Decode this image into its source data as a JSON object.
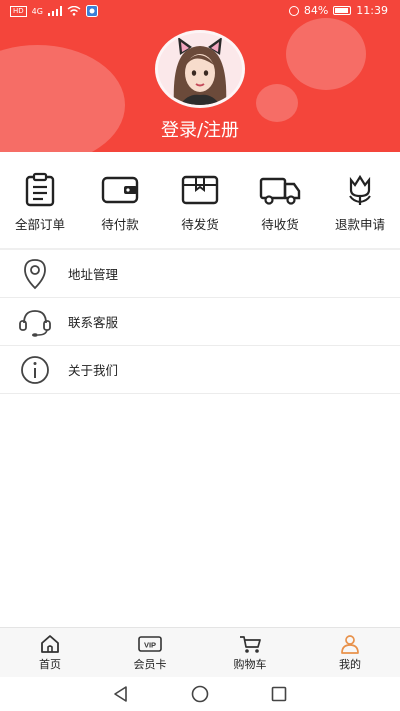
{
  "status_bar": {
    "network_badge": "HD",
    "signal_label": "4G",
    "battery_percent": "84%",
    "time": "11:39",
    "battery_level": 0.84
  },
  "profile": {
    "login_label": "登录/注册",
    "avatar_icon": "cat-ears-girl-avatar"
  },
  "orders": [
    {
      "label": "全部订单",
      "icon": "clipboard-icon"
    },
    {
      "label": "待付款",
      "icon": "wallet-icon"
    },
    {
      "label": "待发货",
      "icon": "package-icon"
    },
    {
      "label": "待收货",
      "icon": "truck-icon"
    },
    {
      "label": "退款申请",
      "icon": "flower-icon"
    }
  ],
  "menu": [
    {
      "label": "地址管理",
      "icon": "location-pin-icon"
    },
    {
      "label": "联系客服",
      "icon": "headset-icon"
    },
    {
      "label": "关于我们",
      "icon": "info-icon"
    }
  ],
  "tabbar": {
    "items": [
      {
        "label": "首页",
        "icon": "home-icon"
      },
      {
        "label": "会员卡",
        "icon": "vip-card-icon",
        "badge": "VIP"
      },
      {
        "label": "购物车",
        "icon": "cart-icon"
      },
      {
        "label": "我的",
        "icon": "profile-icon"
      }
    ],
    "active_index": 3
  },
  "colors": {
    "header_bg": "#f4453b",
    "accent_orange": "#e8914a",
    "text": "#222222"
  }
}
